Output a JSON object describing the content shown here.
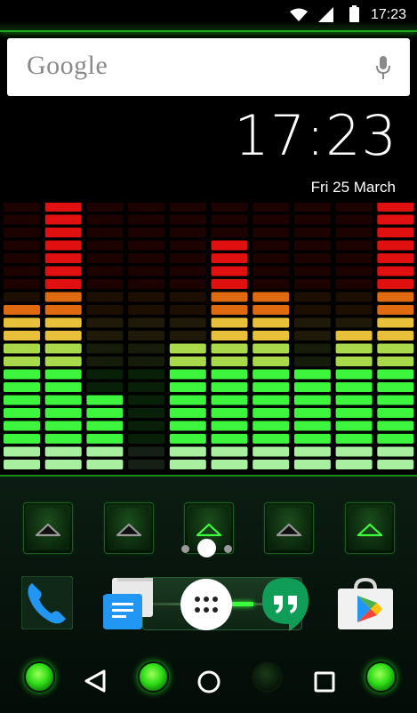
{
  "status_bar": {
    "time": "17:23",
    "icons": [
      "wifi-icon",
      "signal-icon",
      "battery-icon"
    ]
  },
  "search": {
    "logo_text": "Google",
    "icon": "mic-icon"
  },
  "clock": {
    "time": "17:23",
    "date": "Fri 25 March"
  },
  "equalizer": {
    "rows": 21,
    "bar_levels": [
      13,
      21,
      6,
      0,
      10,
      18,
      14,
      8,
      11,
      21
    ],
    "colors": {
      "red": "#e01010",
      "orange": "#e06a10",
      "yellow": "#e8c03a",
      "yellow_green": "#a8d94a",
      "green": "#3cf53c",
      "light_green": "#a8f0a0"
    }
  },
  "folders": [
    {
      "name": "folder-1",
      "icon": "triangle-up-icon",
      "highlight": false
    },
    {
      "name": "folder-2",
      "icon": "triangle-up-icon",
      "highlight": false
    },
    {
      "name": "folder-3",
      "icon": "triangle-up-icon",
      "highlight": true
    },
    {
      "name": "folder-4",
      "icon": "triangle-up-icon",
      "highlight": false
    },
    {
      "name": "folder-5",
      "icon": "triangle-up-icon",
      "highlight": true
    }
  ],
  "page_indicator": {
    "count": 3,
    "active_index": 1
  },
  "dock": {
    "apps": [
      "phone-icon",
      "messenger-icon",
      "app-drawer-icon",
      "hangouts-icon",
      "play-store-icon"
    ]
  },
  "nav_bar": {
    "buttons": [
      "back-icon",
      "home-icon",
      "recents-icon"
    ],
    "leds": [
      true,
      true,
      false,
      true
    ]
  },
  "accent_color": "#2ddc16"
}
